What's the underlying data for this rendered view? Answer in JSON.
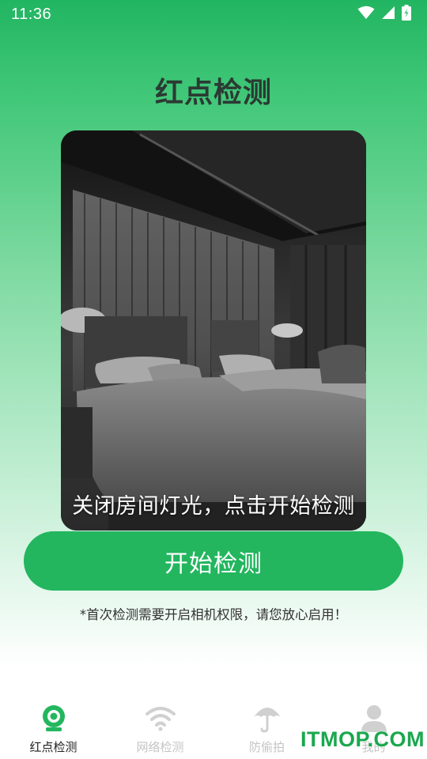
{
  "status_bar": {
    "time": "11:36",
    "icons": [
      "wifi-icon",
      "signal-icon",
      "battery-charging-icon"
    ]
  },
  "page": {
    "title": "红点检测"
  },
  "hero": {
    "caption": "关闭房间灯光，点击开始检测"
  },
  "actions": {
    "start_label": "开始检测"
  },
  "hint": {
    "text": "*首次检测需要开启相机权限，请您放心启用！"
  },
  "tabs": [
    {
      "label": "红点检测",
      "icon": "camera-lens-icon",
      "active": true
    },
    {
      "label": "网络检测",
      "icon": "wifi-icon",
      "active": false
    },
    {
      "label": "防偷拍",
      "icon": "umbrella-icon",
      "active": false
    },
    {
      "label": "我的",
      "icon": "person-icon",
      "active": false
    }
  ],
  "watermark": {
    "text": "ITMOP.COM"
  },
  "colors": {
    "accent": "#23b65f",
    "title_text": "#2b3a33",
    "tab_active": "#23b65f",
    "tab_inactive": "#c4c4c4"
  }
}
